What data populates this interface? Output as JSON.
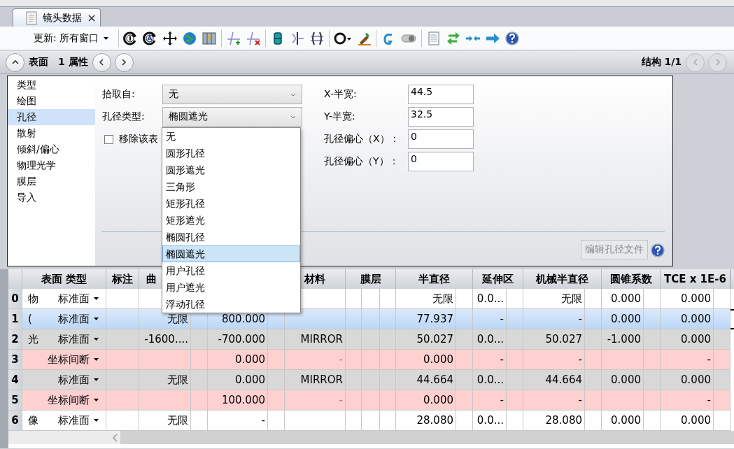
{
  "document_tab": {
    "title": "镜头数据",
    "selected": true
  },
  "toolbar": {
    "update_label": "更新: 所有窗口"
  },
  "nav": {
    "section": "表面",
    "property": "1 属性",
    "config": "结构 1/1",
    "config_buttons_disabled": true
  },
  "panel": {
    "categories": [
      {
        "label": "类型",
        "selected": false
      },
      {
        "label": "绘图",
        "selected": false
      },
      {
        "label": "孔径",
        "selected": true
      },
      {
        "label": "散射",
        "selected": false
      },
      {
        "label": "倾斜/偏心",
        "selected": false
      },
      {
        "label": "物理光学",
        "selected": false
      },
      {
        "label": "膜层",
        "selected": false
      },
      {
        "label": "导入",
        "selected": false
      }
    ],
    "pick_from": {
      "label": "拾取自:",
      "value": "无"
    },
    "aperture_type": {
      "label": "孔径类型:",
      "value": "椭圆遮光",
      "expanded": true,
      "options": [
        {
          "label": "无",
          "selected": false
        },
        {
          "label": "圆形孔径",
          "selected": false
        },
        {
          "label": "圆形遮光",
          "selected": false
        },
        {
          "label": "三角形",
          "selected": false
        },
        {
          "label": "矩形孔径",
          "selected": false
        },
        {
          "label": "矩形遮光",
          "selected": false
        },
        {
          "label": "椭圆孔径",
          "selected": false
        },
        {
          "label": "椭圆遮光",
          "selected": true
        },
        {
          "label": "用户孔径",
          "selected": false
        },
        {
          "label": "用户遮光",
          "selected": false
        },
        {
          "label": "浮动孔径",
          "selected": false
        }
      ]
    },
    "remove_checkbox": {
      "label": "移除该表",
      "checked": false
    },
    "fields": [
      {
        "label": "X-半宽:",
        "value": "44.5"
      },
      {
        "label": "Y-半宽:",
        "value": "32.5"
      },
      {
        "label": "孔径偏心（X）：",
        "value": "0"
      },
      {
        "label": "孔径偏心（Y）：",
        "value": "0"
      }
    ],
    "edit_button": {
      "label": "编辑孔径文件",
      "disabled": true
    }
  },
  "table": {
    "columns": [
      {
        "label": "表面 类型"
      },
      {
        "label": "标注"
      },
      {
        "label": "曲"
      },
      {},
      {
        "label": "材料"
      },
      {
        "label": "膜层"
      },
      {
        "label": "半直径"
      },
      {
        "label": "延伸区"
      },
      {
        "label": "机械半直径"
      },
      {
        "label": "圆锥系数"
      },
      {
        "label": "TCE x 1E-6"
      }
    ],
    "rows": [
      {
        "number": "0",
        "kind": "plain",
        "selected": false,
        "comment": "物",
        "type": "标准面",
        "semi_diameter": "无限",
        "extension": "0.0...",
        "mech_semi_diameter": "无限",
        "conic": "0.000",
        "tce": "0.000"
      },
      {
        "number": "1",
        "kind": "plain",
        "selected": true,
        "comment": "(",
        "type": "标准面",
        "radius": "无限",
        "thickness": "800.000",
        "semi_diameter": "77.937",
        "extension": "-",
        "mech_semi_diameter": "-",
        "conic": "0.000",
        "tce": "0.000"
      },
      {
        "number": "2",
        "kind": "mirror",
        "selected": false,
        "comment": "光",
        "type": "标准面",
        "radius": "-1600....",
        "thickness": "-700.000",
        "material": "MIRROR",
        "semi_diameter": "50.027",
        "extension": "0.0...",
        "mech_semi_diameter": "50.027",
        "conic": "-1.000",
        "tce": "0.000"
      },
      {
        "number": "3",
        "kind": "break",
        "selected": false,
        "type": "坐标间断",
        "thickness": "0.000",
        "material": "-",
        "semi_diameter": "0.000",
        "extension": "-",
        "mech_semi_diameter": "-",
        "tce": "-"
      },
      {
        "number": "4",
        "kind": "mirror",
        "selected": false,
        "type": "标准面",
        "radius": "无限",
        "thickness": "0.000",
        "material": "MIRROR",
        "semi_diameter": "44.664",
        "extension": "0.0...",
        "mech_semi_diameter": "44.664",
        "conic": "0.000",
        "tce": "0.000"
      },
      {
        "number": "5",
        "kind": "break",
        "selected": false,
        "type": "坐标间断",
        "thickness": "100.000",
        "material": "-",
        "semi_diameter": "0.000",
        "extension": "-",
        "mech_semi_diameter": "-",
        "tce": "-"
      },
      {
        "number": "6",
        "kind": "plain",
        "selected": false,
        "comment": "像",
        "type": "标准面",
        "radius": "无限",
        "thickness": "-",
        "semi_diameter": "28.080",
        "extension": "0.0...",
        "mech_semi_diameter": "28.080",
        "conic": "0.000",
        "tce": "0.000"
      }
    ]
  }
}
